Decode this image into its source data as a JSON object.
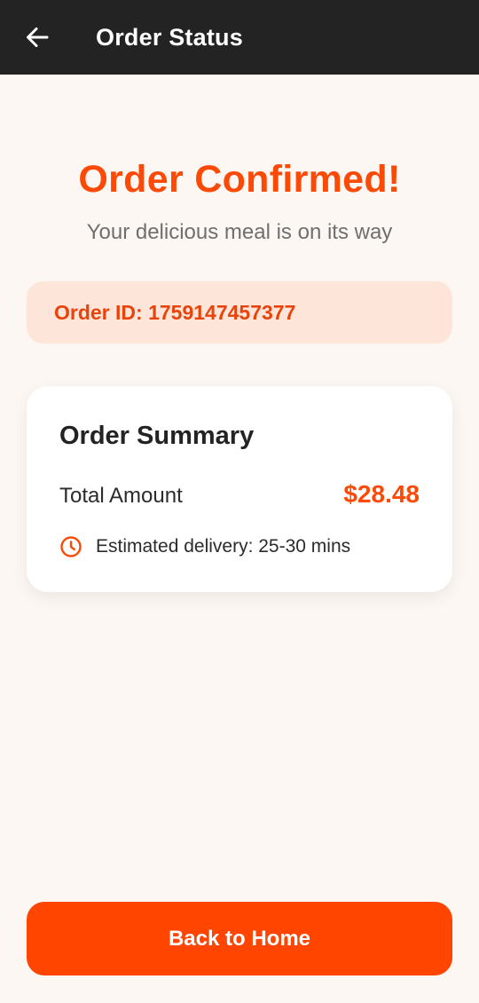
{
  "header": {
    "title": "Order Status",
    "back_icon": "arrow-left-icon"
  },
  "confirmation": {
    "title": "Order Confirmed!",
    "subtitle": "Your delicious meal is on its way"
  },
  "order": {
    "id_text": "Order ID: 1759147457377"
  },
  "summary": {
    "title": "Order Summary",
    "total_label": "Total Amount",
    "total_value": "$28.48",
    "delivery_icon": "clock-icon",
    "delivery_text": "Estimated delivery: 25-30 mins"
  },
  "actions": {
    "home_label": "Back to Home"
  },
  "colors": {
    "accent": "#fb4a06",
    "button": "#ff4500",
    "header_bg": "#232323",
    "page_bg": "#fdf7f3",
    "id_box_bg": "#fde5da"
  }
}
